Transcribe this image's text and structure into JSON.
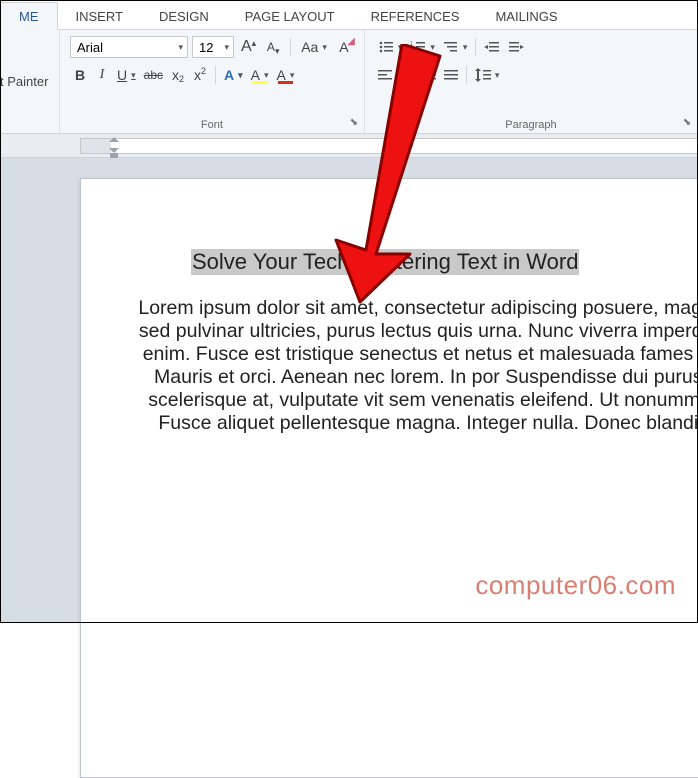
{
  "tabs": {
    "home": "ME",
    "insert": "INSERT",
    "design": "DESIGN",
    "page_layout": "PAGE LAYOUT",
    "references": "REFERENCES",
    "mailings": "MAILINGS"
  },
  "clipboard": {
    "format_painter": "t Painter"
  },
  "font": {
    "name": "Arial",
    "size": "12",
    "grow_label": "A",
    "shrink_label": "A",
    "case_label": "Aa",
    "clear_label": "A",
    "bold": "B",
    "italic": "I",
    "underline": "U",
    "strike": "abc",
    "subscript_base": "x",
    "superscript_base": "x",
    "effects": "A",
    "highlight": "A",
    "color": "A",
    "group_label": "Font"
  },
  "paragraph": {
    "group_label": "Paragraph"
  },
  "document": {
    "heading": "Solve Your Tech Centering Text in Word",
    "body": "Lorem ipsum dolor sit amet, consectetur adipiscing posuere, magna sed pulvinar ultricies, purus lectus quis urna. Nunc viverra imperdiet enim. Fusce est tristique senectus et netus et malesuada fames ac Mauris et orci. Aenean nec lorem. In por Suspendisse dui purus, scelerisque at, vulputate vit sem venenatis eleifend. Ut nonummy. Fusce aliquet pellentesque magna. Integer nulla. Donec blandit"
  },
  "watermark": "computer06.com"
}
